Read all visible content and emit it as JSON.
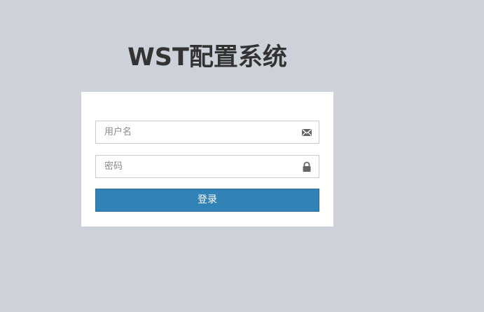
{
  "page": {
    "title": "WST配置系统"
  },
  "login_form": {
    "username": {
      "value": "",
      "placeholder": "用户名",
      "icon": "envelope-icon"
    },
    "password": {
      "value": "",
      "placeholder": "密码",
      "icon": "lock-icon"
    },
    "submit_label": "登录"
  },
  "colors": {
    "background": "#cdd1da",
    "panel": "#ffffff",
    "title_text": "#333333",
    "button": "#3182b6",
    "button_text": "#ffffff",
    "icon": "#666666"
  }
}
